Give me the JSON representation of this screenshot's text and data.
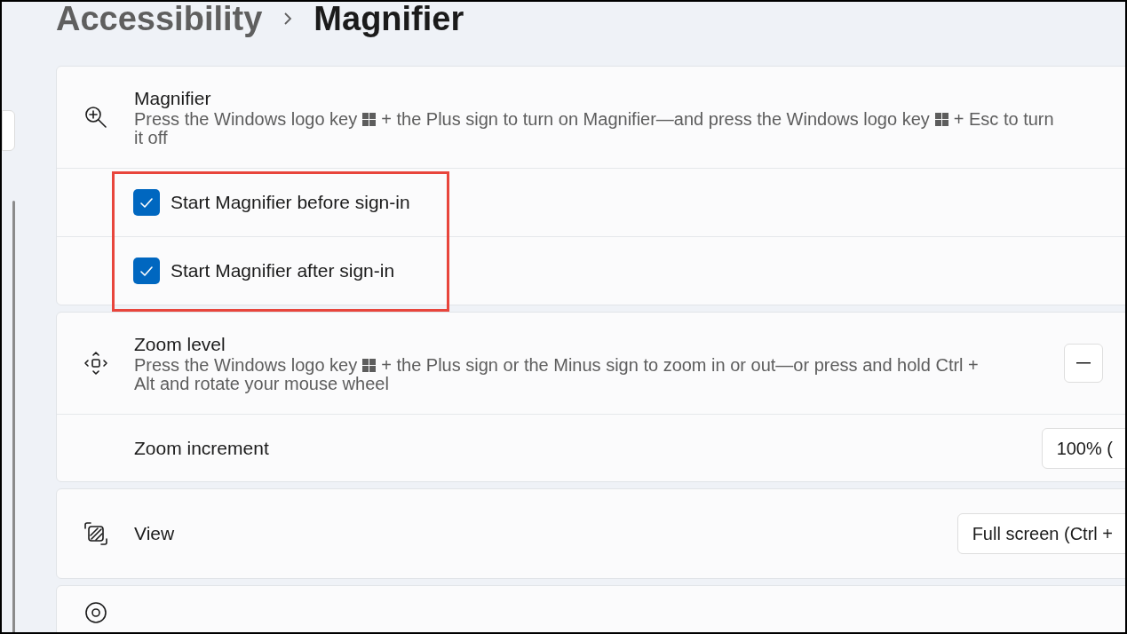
{
  "breadcrumb": [
    {
      "label": "Accessibility",
      "current": false
    },
    {
      "label": "Magnifier",
      "current": true
    }
  ],
  "cards": [
    {
      "rows": [
        {
          "kind": "setting",
          "title": "Magnifier",
          "description_lines": [
            [
              "Press the Windows logo key",
              "+ the Plus sign to turn on Magnifier—and press the Windows logo key",
              "+ Esc to turn"
            ],
            [
              "it off"
            ]
          ]
        },
        {
          "kind": "checkbox",
          "label": "Start Magnifier before sign-in",
          "checked": true
        },
        {
          "kind": "checkbox",
          "label": "Start Magnifier after sign-in",
          "checked": true
        }
      ]
    },
    {
      "rows": [
        {
          "kind": "setting",
          "title": "Zoom level",
          "description_lines": [
            [
              "Press the Windows logo key",
              "+ the Plus sign or the Minus sign to zoom in or out—or press and hold Ctrl +"
            ],
            [
              "Alt and rotate your mouse wheel"
            ]
          ],
          "control": {
            "kind": "minus-button"
          }
        },
        {
          "kind": "setting",
          "title": "Zoom increment",
          "control": {
            "kind": "dropdown",
            "value": "100% ("
          }
        }
      ]
    },
    {
      "rows": [
        {
          "kind": "setting",
          "title": "View",
          "control": {
            "kind": "dropdown",
            "value": "Full screen (Ctrl +"
          }
        }
      ]
    },
    {
      "rows": [
        {
          "kind": "setting"
        }
      ]
    }
  ]
}
